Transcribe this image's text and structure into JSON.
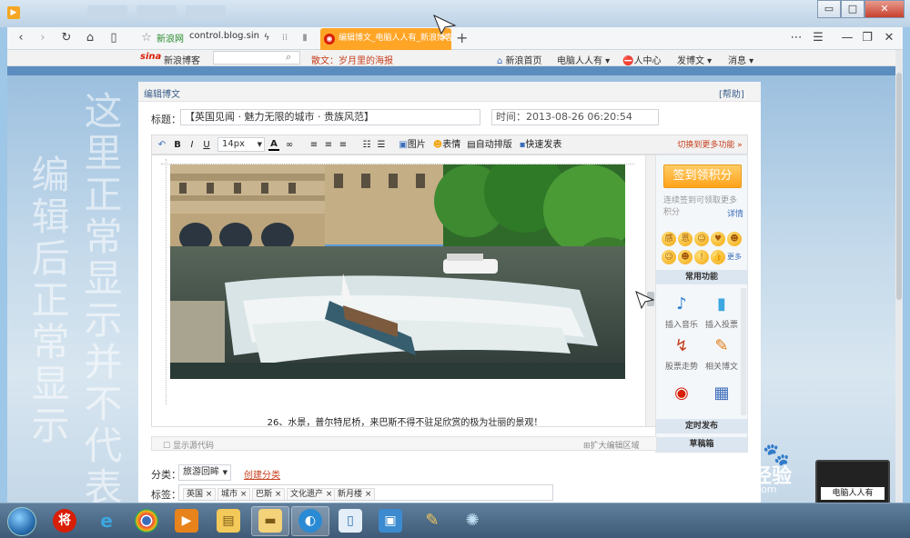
{
  "browser": {
    "title_ghost_tabs": [
      "",
      "",
      ""
    ],
    "tab_title": "编辑博文_电脑人人有_新浪博客",
    "tab_close": "×",
    "new_tab": "+",
    "address_site": "新浪网",
    "address_url": "control.blog.sin",
    "window_controls": {
      "min": "▭",
      "max": "□",
      "close": "✕"
    },
    "right_tools": [
      "⋯",
      "☰",
      "—",
      "❐",
      "✕"
    ]
  },
  "sina_bar": {
    "logo": "新浪博客",
    "search_placeholder": "",
    "marquee": "散文：岁月里的海报",
    "links": [
      "新浪首页",
      "电脑人人有 ▾",
      "人中心",
      "发博文 ▾",
      "消息 ▾"
    ]
  },
  "watermark_columns": [
    "这里正常显示并不代表",
    "编辑后正常显示"
  ],
  "editor": {
    "header": "编辑博文",
    "help": "[帮助]",
    "title_label": "标题：",
    "title_value": "【英国见闻 · 魅力无限的城市 · 贵族风范】",
    "time_value": "时间：2013-08-26 06:20:54",
    "toolbar": {
      "undo": "↶",
      "bold": "B",
      "italic": "I",
      "underline": "U",
      "font_size": "14px",
      "color": "A",
      "link": "∞",
      "image": "图片",
      "emoji": "表情",
      "autoformat": "自动排版",
      "quickpost": "快速发表",
      "more": "切换到更多功能 »"
    },
    "caption": "26、水景，普尔特尼桥，来巴斯不得不驻足欣赏的极为壮丽的景观！",
    "show_source": "显示源代码",
    "expand": "扩大编辑区域",
    "category_label": "分类：",
    "category_value": "旅游回眸",
    "create_category": "创建分类",
    "tags_label": "标签：",
    "tags": [
      "英国",
      "城市",
      "巴斯",
      "文化遗产",
      "新月楼"
    ]
  },
  "side_panel": {
    "signin": "签到领积分",
    "signin_tip": "连续签到可领取更多积分",
    "signin_detail": "详情",
    "emoji": [
      "感",
      "恩",
      "☺",
      "♥",
      "☻",
      "☺",
      "☻",
      "!",
      "👍",
      "更多"
    ],
    "section_common": "常用功能",
    "functions": [
      {
        "icon": "music-icon",
        "glyph": "♪",
        "label": "插入音乐"
      },
      {
        "icon": "vote-icon",
        "glyph": "▮",
        "label": "插入投票"
      },
      {
        "icon": "stock-icon",
        "glyph": "↯",
        "label": "股票走势"
      },
      {
        "icon": "related-icon",
        "glyph": "✎",
        "label": "相关博文"
      },
      {
        "icon": "weibo-icon",
        "glyph": "◉",
        "label": ""
      },
      {
        "icon": "grid-icon",
        "glyph": "▦",
        "label": ""
      }
    ],
    "section_timed": "定时发布",
    "section_draft": "草稿箱"
  },
  "baidu": {
    "brand": "Bai",
    "paw": "du",
    "jingyan": "经验",
    "url": "jingyan.baidu.com"
  },
  "laptop_caption": "电脑人人有",
  "taskbar_icons": [
    "start-orb",
    "jiang-icon",
    "ie-icon",
    "chrome-icon",
    "media-icon",
    "explorer-icon",
    "folder-icon",
    "browser360-icon",
    "paint-icon",
    "network-icon",
    "paint2-icon",
    "spin-icon"
  ],
  "colors": {
    "accent_orange": "#ffa526",
    "sina_red": "#d81e06",
    "link_blue": "#3c6dbb"
  }
}
